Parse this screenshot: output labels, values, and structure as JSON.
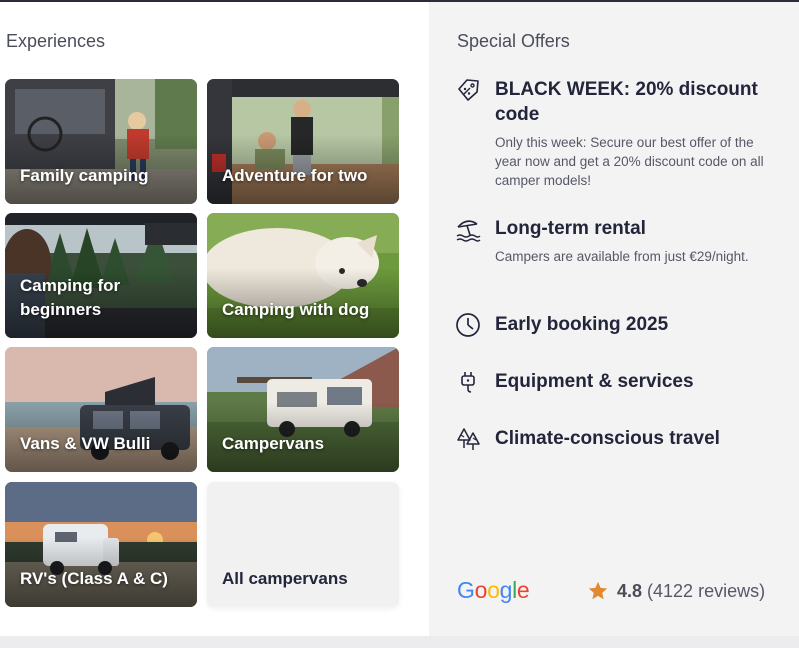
{
  "experiences": {
    "heading": "Experiences",
    "tiles": [
      {
        "label": "Family camping"
      },
      {
        "label": "Adventure for two"
      },
      {
        "label": "Camping for beginners"
      },
      {
        "label": "Camping with dog"
      },
      {
        "label": "Vans & VW Bulli"
      },
      {
        "label": "Campervans"
      },
      {
        "label": "RV's (Class A & C)"
      },
      {
        "label": "All campervans"
      }
    ]
  },
  "offers": {
    "heading": "Special Offers",
    "items": [
      {
        "title": "BLACK WEEK: 20% discount code",
        "description": "Only this week: Secure our best offer of the year now and get a 20% discount code on all camper models!",
        "icon": "tag-percent-icon"
      },
      {
        "title": "Long-term rental",
        "description": "Campers are available from just €29/night.",
        "icon": "beach-umbrella-icon"
      },
      {
        "title": "Early booking 2025",
        "description": "",
        "icon": "clock-icon"
      },
      {
        "title": "Equipment & services",
        "description": "",
        "icon": "plug-icon"
      },
      {
        "title": "Climate-conscious travel",
        "description": "",
        "icon": "trees-icon"
      }
    ]
  },
  "reviews": {
    "provider": "Google",
    "score": "4.8",
    "count_text": "(4122 reviews)",
    "star_color": "#e0892e"
  },
  "colors": {
    "google_blue": "#4285f4",
    "google_red": "#ea4335",
    "google_yellow": "#fbbc05",
    "google_green": "#34a853",
    "text_dark": "#23253a"
  }
}
